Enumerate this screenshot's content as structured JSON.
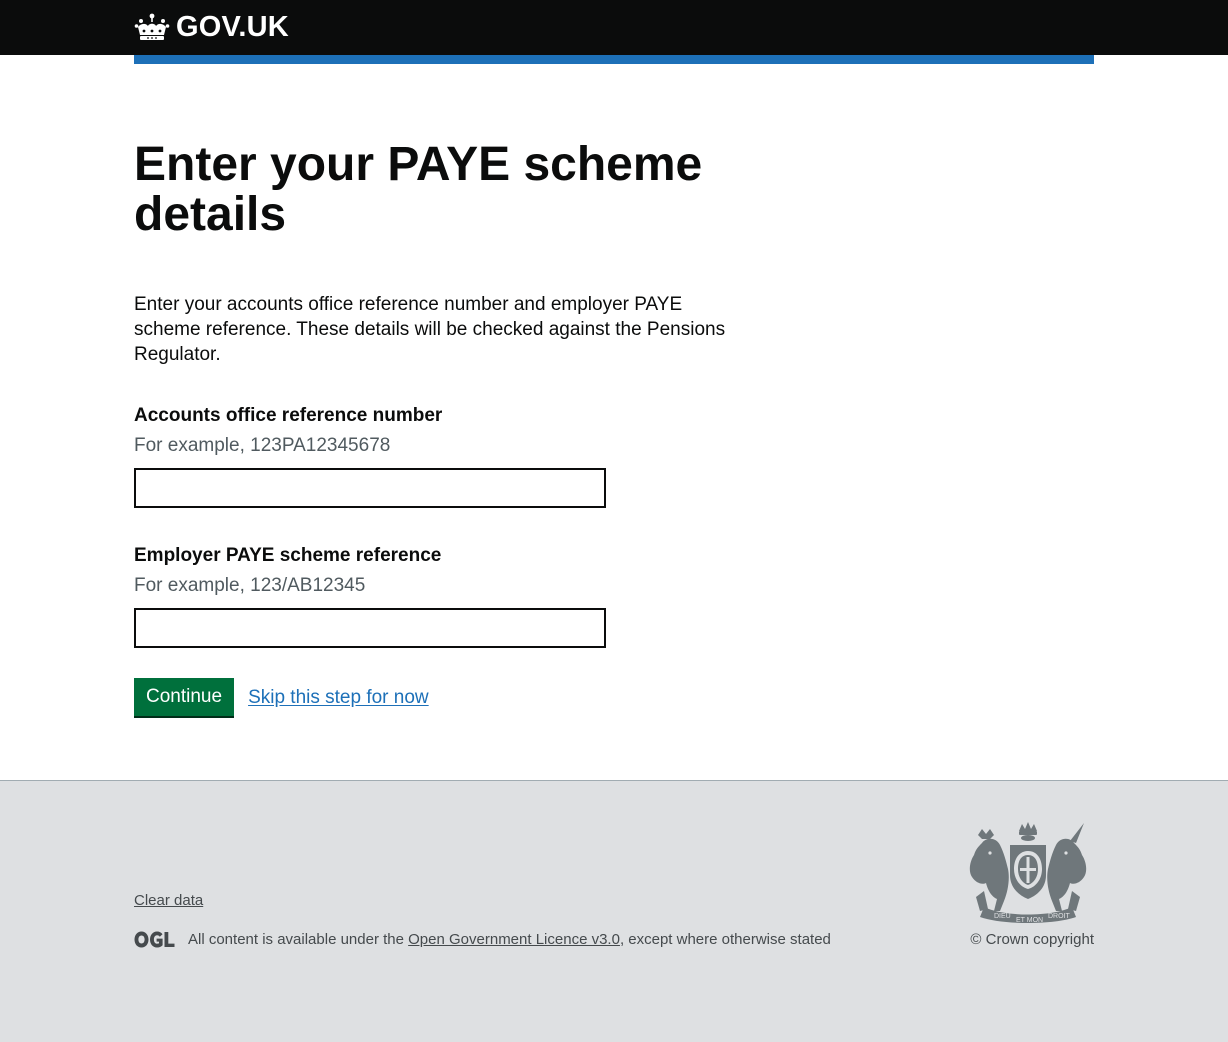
{
  "header": {
    "logo_text": "GOV.UK",
    "crown_icon": "crown-icon",
    "accent_color": "#1d70b8"
  },
  "main": {
    "title": "Enter your PAYE scheme details",
    "intro": "Enter your accounts office reference number and employer PAYE scheme reference. These details will be checked against the Pensions Regulator.",
    "fields": [
      {
        "label": "Accounts office reference number",
        "hint": "For example, 123PA12345678",
        "value": ""
      },
      {
        "label": "Employer PAYE scheme reference",
        "hint": "For example, 123/AB12345",
        "value": ""
      }
    ],
    "continue_label": "Continue",
    "skip_label": "Skip this step for now",
    "button_color": "#00703c"
  },
  "footer": {
    "clear_data": "Clear data",
    "ogl_icon": "ogl-logo",
    "licence_prefix": "All content is available under the ",
    "licence_link": "Open Government Licence v3.0",
    "licence_suffix": ", except where otherwise stated",
    "crest_icon": "royal-coat-of-arms",
    "crest_motto_1": "DIEU",
    "crest_motto_2": "ET MON",
    "crest_motto_3": "DROIT",
    "copyright": "© Crown copyright"
  }
}
